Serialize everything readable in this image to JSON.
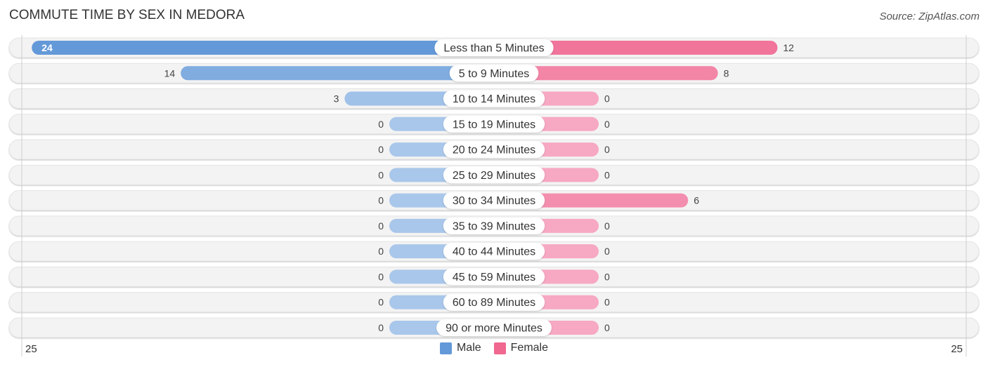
{
  "title": "COMMUTE TIME BY SEX IN MEDORA",
  "source": "Source: ZipAtlas.com",
  "colors": {
    "male": "#6399d8",
    "male_light": "#a9c7ea",
    "female": "#f06790",
    "female_light": "#f7a8c2",
    "track": "#f3f3f3"
  },
  "legend": [
    {
      "label": "Male",
      "color": "#6399d8"
    },
    {
      "label": "Female",
      "color": "#f06790"
    }
  ],
  "axis": {
    "left_label": "25",
    "right_label": "25"
  },
  "chart_data": {
    "type": "bar",
    "orientation": "horizontal-diverging",
    "title": "COMMUTE TIME BY SEX IN MEDORA",
    "categories": [
      "Less than 5 Minutes",
      "5 to 9 Minutes",
      "10 to 14 Minutes",
      "15 to 19 Minutes",
      "20 to 24 Minutes",
      "25 to 29 Minutes",
      "30 to 34 Minutes",
      "35 to 39 Minutes",
      "40 to 44 Minutes",
      "45 to 59 Minutes",
      "60 to 89 Minutes",
      "90 or more Minutes"
    ],
    "series": [
      {
        "name": "Male",
        "values": [
          24,
          14,
          3,
          0,
          0,
          0,
          0,
          0,
          0,
          0,
          0,
          0
        ]
      },
      {
        "name": "Female",
        "values": [
          12,
          8,
          0,
          0,
          0,
          0,
          6,
          0,
          0,
          0,
          0,
          0
        ]
      }
    ],
    "xlim": [
      -25,
      25
    ],
    "tick_labels": [
      "25",
      "25"
    ],
    "legend_position": "bottom-center",
    "grid": false
  }
}
